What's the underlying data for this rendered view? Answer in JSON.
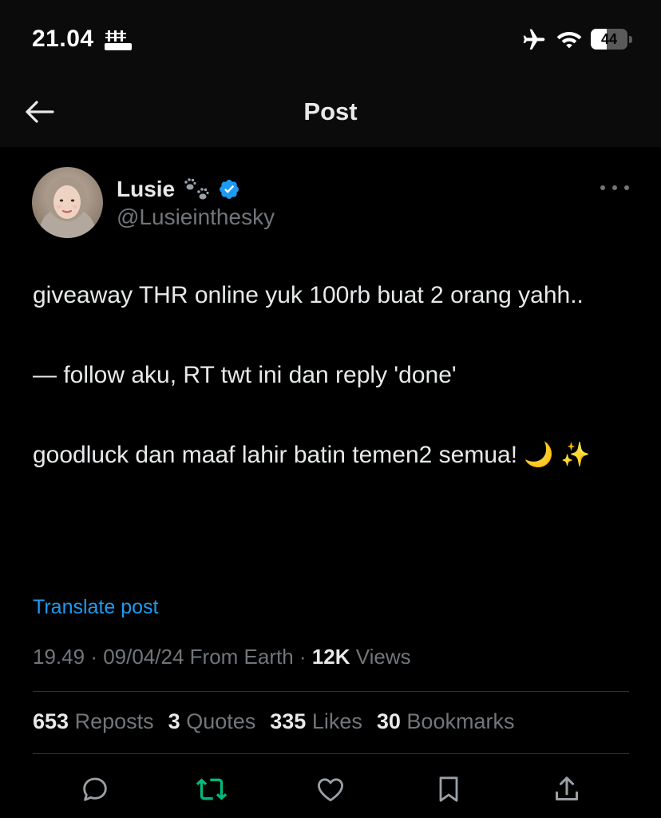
{
  "status_bar": {
    "time": "21.04",
    "battery": "44",
    "battery_level": 0.44
  },
  "nav": {
    "title": "Post"
  },
  "author": {
    "display_name": "Lusie",
    "handle": "@Lusieinthesky"
  },
  "post": {
    "lines": [
      "giveaway THR online yuk 100rb buat 2 orang yahh..",
      "— follow aku, RT twt ini dan reply 'done'",
      "goodluck dan maaf lahir batin temen2 semua! 🌙 ✨"
    ],
    "translate_label": "Translate post",
    "time": "19.49",
    "date": "09/04/24",
    "source": "From Earth",
    "views_count": "12K",
    "views_label": "Views"
  },
  "stats": {
    "reposts": {
      "count": "653",
      "label": "Reposts"
    },
    "quotes": {
      "count": "3",
      "label": "Quotes"
    },
    "likes": {
      "count": "335",
      "label": "Likes"
    },
    "bookmarks": {
      "count": "30",
      "label": "Bookmarks"
    }
  },
  "actions": [
    "reply-icon",
    "repost-icon",
    "like-icon",
    "bookmark-icon",
    "share-icon"
  ],
  "colors": {
    "background": "#000000",
    "text": "#e7e9ea",
    "secondary_text": "#71767b",
    "link": "#1d9bf0",
    "verified": "#1d9bf0",
    "repost_active": "#00ba7c",
    "divider": "#2f3336"
  }
}
